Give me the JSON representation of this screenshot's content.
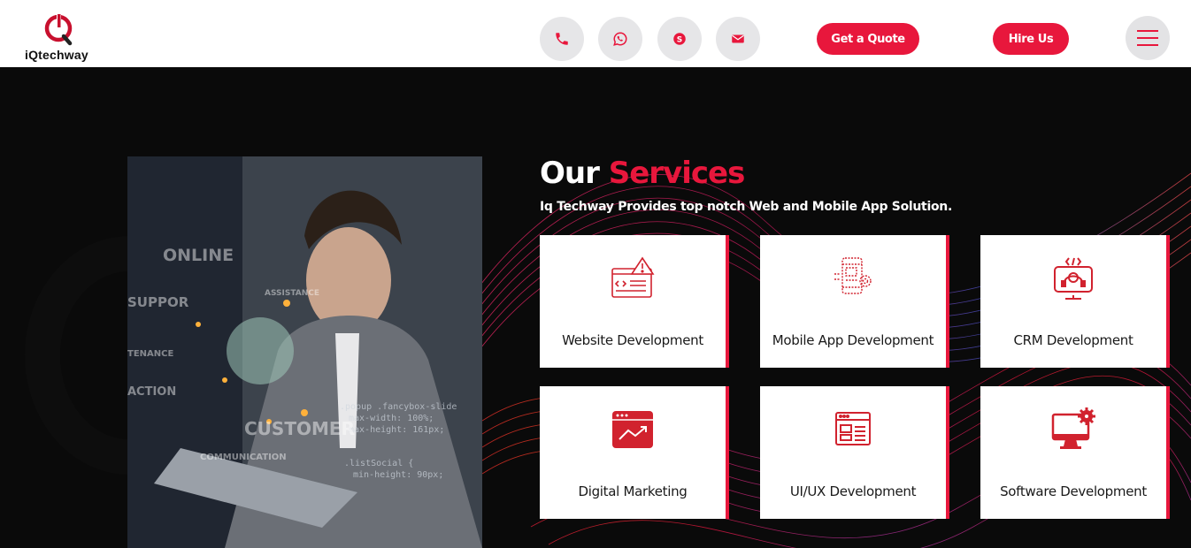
{
  "brand": {
    "name": "iQtechway",
    "accent": "#e8173c"
  },
  "header": {
    "contacts": [
      {
        "icon": "phone-icon"
      },
      {
        "icon": "whatsapp-icon"
      },
      {
        "icon": "skype-icon"
      },
      {
        "icon": "mail-icon"
      }
    ],
    "quote_label": "Get a Quote",
    "hire_label": "Hire Us",
    "menu_icon": "hamburger-menu-icon"
  },
  "hero": {
    "title_main": "Our",
    "title_accent": "Services",
    "subtitle": "Iq Techway Provides top notch Web and Mobile App Solution.",
    "image": {
      "overlay_words": [
        "ONLINE",
        "SUPPOR",
        "ASSISTANCE",
        "TENANCE",
        "ACTION",
        "CUSTOMER",
        "COMMUNICATION"
      ]
    }
  },
  "services": [
    {
      "label": "Website Development",
      "icon": "web-code-icon"
    },
    {
      "label": "Mobile App Development",
      "icon": "mobile-settings-icon"
    },
    {
      "label": "CRM Development",
      "icon": "headset-monitor-icon"
    },
    {
      "label": "Digital Marketing",
      "icon": "growth-browser-icon"
    },
    {
      "label": "UI/UX Development",
      "icon": "layout-window-icon"
    },
    {
      "label": "Software Development",
      "icon": "desktop-gear-icon"
    }
  ]
}
